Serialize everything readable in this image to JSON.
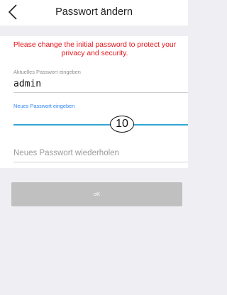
{
  "header": {
    "title": "Passwort ändern",
    "back_icon": "chevron-left-icon"
  },
  "warning": "Please change the initial password to protect your privacy and security.",
  "fields": {
    "current": {
      "label": "Aktuelles Passwort eingeben",
      "value": "admin"
    },
    "new_password": {
      "label": "Neues Passwort eingeben",
      "value": ""
    },
    "repeat": {
      "placeholder": "Neues Passwort wiederholen"
    }
  },
  "marker": "10",
  "ok_button": "oK",
  "colors": {
    "warning": "#e4161b",
    "active_label": "#2f86f6",
    "active_underline": "#31a6d4",
    "button": "#c0c0c0",
    "background": "#eeeef3"
  }
}
